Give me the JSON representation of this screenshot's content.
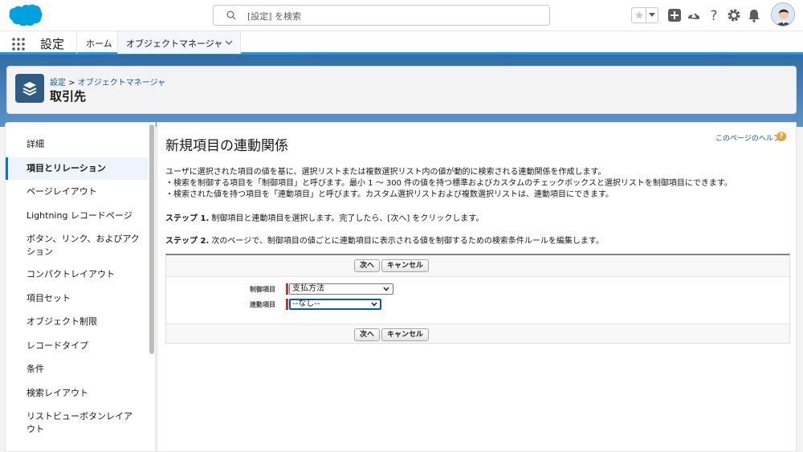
{
  "header": {
    "search_placeholder": "[設定] を検索"
  },
  "nav": {
    "app_name": "設定",
    "tabs": [
      {
        "label": "ホーム"
      },
      {
        "label": "オブジェクトマネージャ"
      }
    ]
  },
  "page_header": {
    "breadcrumb_link": "設定",
    "breadcrumb_sep": " > ",
    "breadcrumb_current": "オブジェクトマネージャ",
    "title": "取引先"
  },
  "sidebar": {
    "items": [
      {
        "label": "詳細"
      },
      {
        "label": "項目とリレーション"
      },
      {
        "label": "ページレイアウト"
      },
      {
        "label": "Lightning レコードページ"
      },
      {
        "label": "ボタン、リンク、およびアク"
      },
      {
        "label": "ション"
      },
      {
        "label": "コンパクトレイアウト"
      },
      {
        "label": "項目セット"
      },
      {
        "label": "オブジェクト制限"
      },
      {
        "label": "レコードタイプ"
      },
      {
        "label": "条件"
      },
      {
        "label": "検索レイアウト"
      },
      {
        "label": "リストビューボタンレイア"
      },
      {
        "label": "ウト"
      }
    ]
  },
  "main": {
    "title": "新規項目の連動関係",
    "help_link": "このページのヘルプ",
    "help_icon": "?",
    "desc_lines": [
      "ユーザに選択された項目の値を基に、選択リストまたは複数選択リスト内の値が動的に検索される連動関係を作成します。",
      "・検索を制御する項目を「制御項目」と呼びます。最小 1 〜 300 件の値を持つ標準およびカスタムのチェックボックスと選択リストを制御項目にできます。",
      "・検索された値を持つ項目を「連動項目」と呼びます。カスタム選択リストおよび複数選択リストは、連動項目にできます。"
    ],
    "step1_label": "ステップ 1.",
    "step1_text": " 制御項目と連動項目を選択します。完了したら、[次へ] をクリックします。",
    "step2_label": "ステップ 2.",
    "step2_text": " 次のページで、制御項目の値ごとに連動項目に表示される値を制御するための検索条件ルールを編集します。",
    "next_button": "次へ",
    "cancel_button": "キャンセル",
    "controlling_label": "制御項目",
    "controlling_value": "支払方法",
    "dependent_label": "連動項目",
    "dependent_value": "--なし--"
  },
  "colors": {
    "brand": "#0176d3",
    "required": "#c23934",
    "link": "#0b5cab"
  }
}
